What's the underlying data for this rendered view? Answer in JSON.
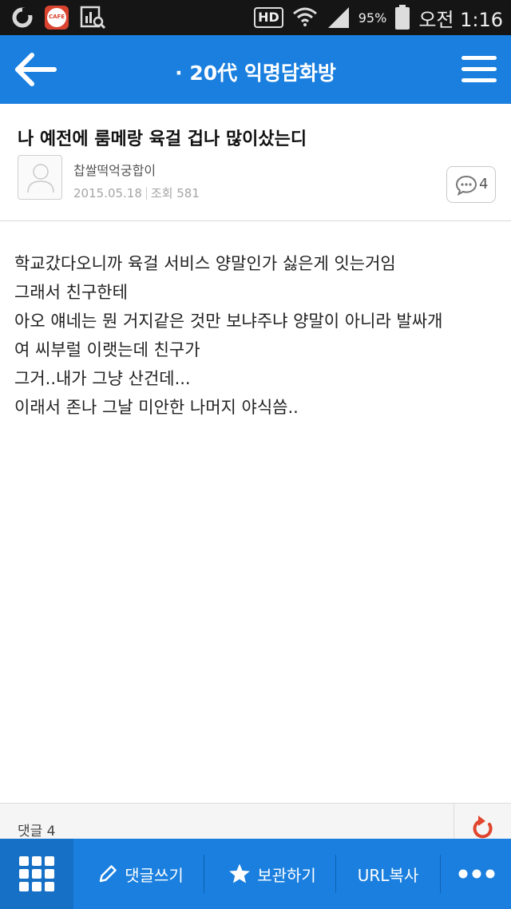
{
  "status_bar": {
    "battery_percent": "95%",
    "time": "오전 1:16",
    "hd_label": "HD",
    "cafe_badge": "CAFE",
    "icons": [
      "o-app-icon",
      "cafe-app-icon",
      "chart-search-icon",
      "hd-voice-icon",
      "wifi-icon",
      "signal-icon",
      "battery-icon"
    ]
  },
  "appbar": {
    "title": "· 20代 익명담화방",
    "back_icon": "back-arrow-icon",
    "menu_icon": "hamburger-menu-icon"
  },
  "post": {
    "title": "나 예전에 룸메랑 육걸 겁나 많이샀는디",
    "author": "찹쌀떡억궁합이",
    "date": "2015.05.18",
    "views": "조회 581",
    "comment_count": "4",
    "body_lines": [
      "학교갔다오니까 육걸 서비스 양말인가 싫은게 잇는거임",
      "그래서 친구한테",
      "아오 얘네는 뭔 거지같은 것만 보냐주냐 양말이 아니라 발싸개",
      "여 씨부럴 이랫는데 친구가",
      "그거..내가 그냥 산건데...",
      "이래서 존나 그날 미안한 나머지 야식씀.."
    ]
  },
  "comments_strip": {
    "label": "댓글 4"
  },
  "toolbar": {
    "write_comment": "댓글쓰기",
    "save": "보관하기",
    "copy_url": "URL복사"
  },
  "colors": {
    "accent": "#1a7fde",
    "refresh": "#e0452d",
    "status_bar": "#151515"
  }
}
